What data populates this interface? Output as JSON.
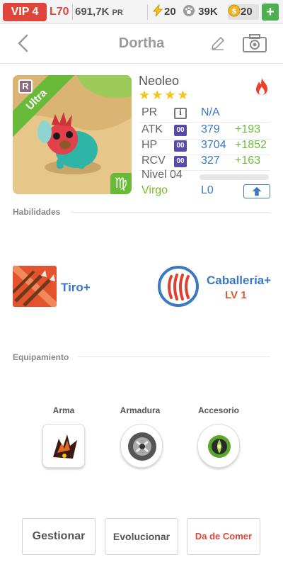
{
  "topbar": {
    "vip_label": "VIP 4",
    "level": "L70",
    "pr_value": "691,7K",
    "pr_unit": "PR",
    "energy": "20",
    "paws": "39K",
    "coins": "20",
    "add_label": "+"
  },
  "header": {
    "title": "Dortha",
    "back_icon": "chevron-left-icon",
    "edit_icon": "pencil-icon",
    "camera_icon": "camera-icon"
  },
  "monster": {
    "rarity_badge": "R",
    "tier": "Ultra",
    "species": "Neoleo",
    "stars": "★★★★",
    "zodiac_symbol": "♍",
    "element_icon": "fire-icon",
    "stats": [
      {
        "label": "PR",
        "icon": "i",
        "value": "N/A",
        "bonus": ""
      },
      {
        "label": "ATK",
        "icon": "00",
        "value": "379",
        "bonus": "+193"
      },
      {
        "label": "HP",
        "icon": "00",
        "value": "3704",
        "bonus": "+1852"
      },
      {
        "label": "RCV",
        "icon": "00",
        "value": "327",
        "bonus": "+163"
      }
    ],
    "level_label": "Nivel 04",
    "zodiac_name": "Virgo",
    "limit_level": "L0"
  },
  "skills": {
    "section_title": "Habilidades",
    "items": [
      {
        "name": "Tiro+",
        "level": ""
      },
      {
        "name": "Caballería+",
        "level": "LV 1"
      }
    ]
  },
  "equipment": {
    "section_title": "Equipamiento",
    "slots": [
      {
        "label": "Arma"
      },
      {
        "label": "Armadura"
      },
      {
        "label": "Accesorio"
      }
    ]
  },
  "actions": {
    "manage": "Gestionar",
    "evolve": "Evolucionar",
    "feed": "Da de Comer"
  },
  "colors": {
    "accent_red": "#e0453b",
    "stat_blue": "#3a78c2",
    "bonus_green": "#6abf3a",
    "ultra_green": "#6aba3a"
  }
}
